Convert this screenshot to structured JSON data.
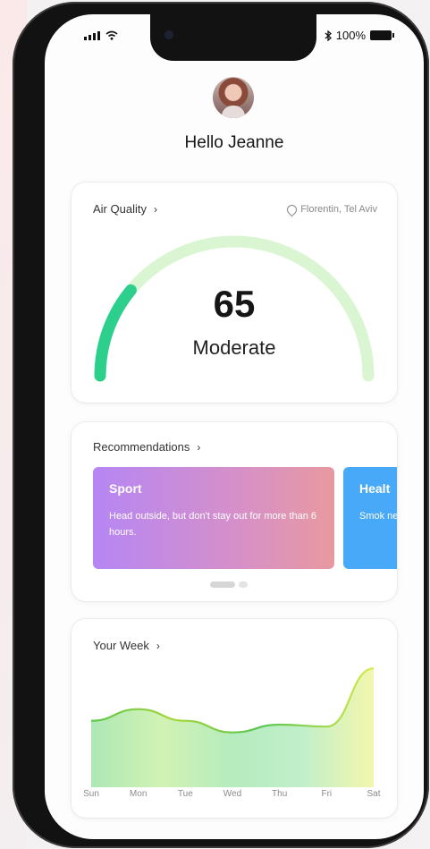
{
  "status": {
    "battery_text": "100%"
  },
  "user": {
    "greeting": "Hello Jeanne"
  },
  "air_quality": {
    "title": "Air Quality",
    "location": "Florentin, Tel Aviv",
    "value": "65",
    "level": "Moderate",
    "gauge_fill_fraction": 0.22,
    "colors": {
      "fill": "#2dcf8c",
      "track": "#d9f5d2"
    }
  },
  "recommendations": {
    "title": "Recommendations",
    "cards": [
      {
        "title": "Sport",
        "text": "Head outside, but don't stay out for more than 6 hours."
      },
      {
        "title": "Healt",
        "text": "Smok negat"
      }
    ]
  },
  "week": {
    "title": "Your Week",
    "days": [
      "Sun",
      "Mon",
      "Tue",
      "Wed",
      "Thu",
      "Fri",
      "Sat"
    ],
    "values": [
      66,
      72,
      66,
      60,
      64,
      63,
      93
    ]
  }
}
